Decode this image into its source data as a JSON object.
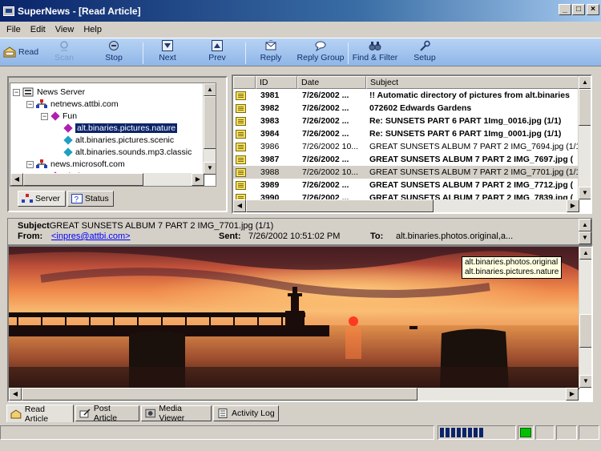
{
  "window": {
    "title": "SuperNews - [Read Article]",
    "minimize": "_",
    "maximize": "□",
    "close": "×"
  },
  "menu": [
    "File",
    "Edit",
    "View",
    "Help"
  ],
  "toolbar": {
    "read": "Read",
    "scan": "Scan",
    "stop": "Stop",
    "next": "Next",
    "prev": "Prev",
    "reply": "Reply",
    "reply_group": "Reply Group",
    "find_filter": "Find & Filter",
    "setup": "Setup"
  },
  "tree": {
    "root": "News Server",
    "server1": "netnews.attbi.com",
    "folder": "Fun",
    "groups": [
      "alt.binaries.pictures.nature",
      "alt.binaries.pictures.scenic",
      "alt.binaries.sounds.mp3.classic"
    ],
    "server2": "news.microsoft.com",
    "folder2": "windows"
  },
  "tree_tabs": {
    "server": "Server",
    "status": "Status"
  },
  "list": {
    "columns": {
      "id": "ID",
      "date": "Date",
      "subject": "Subject"
    },
    "rows": [
      {
        "id": "3981",
        "date": "7/26/2002 ...",
        "subject": "!! Automatic directory of pictures from alt.binaries",
        "bold": true
      },
      {
        "id": "3982",
        "date": "7/26/2002 ...",
        "subject": "072602 Edwards Gardens",
        "bold": true
      },
      {
        "id": "3983",
        "date": "7/26/2002 ...",
        "subject": "Re: SUNSETS PART 6 PART 1Img_0016.jpg (1/1)",
        "bold": true
      },
      {
        "id": "3984",
        "date": "7/26/2002 ...",
        "subject": "Re: SUNSETS PART 6 PART 1Img_0001.jpg (1/1)",
        "bold": true
      },
      {
        "id": "3986",
        "date": "7/26/2002 10...",
        "subject": "GREAT SUNSETS ALBUM 7 PART  2  IMG_7694.jpg (1/1)",
        "bold": false
      },
      {
        "id": "3987",
        "date": "7/26/2002 ...",
        "subject": "GREAT SUNSETS ALBUM 7 PART  2  IMG_7697.jpg (",
        "bold": true
      },
      {
        "id": "3988",
        "date": "7/26/2002 10...",
        "subject": "GREAT SUNSETS ALBUM 7 PART  2  IMG_7701.jpg (1/1)",
        "bold": false,
        "selected": true
      },
      {
        "id": "3989",
        "date": "7/26/2002 ...",
        "subject": "GREAT SUNSETS ALBUM 7 PART  2  IMG_7712.jpg (",
        "bold": true
      },
      {
        "id": "3990",
        "date": "7/26/2002 ...",
        "subject": "GREAT SUNSETS ALBUM 7 PART  2  IMG_7839.jpg (",
        "bold": true
      }
    ]
  },
  "article": {
    "subject_label": "Subject",
    "subject": "GREAT SUNSETS ALBUM 7 PART  2  IMG_7701.jpg (1/1)",
    "from_label": "From:",
    "from": "<inpres@attbi.com>",
    "sent_label": "Sent:",
    "sent": "7/26/2002 10:51:02 PM",
    "to_label": "To:",
    "to": "alt.binaries.photos.original,a...",
    "tooltip": [
      "alt.binaries.photos.original",
      "alt.binaries.pictures.nature"
    ]
  },
  "bottom_tabs": {
    "read_article": "Read Article",
    "post_article": "Post Article",
    "media_viewer": "Media Viewer",
    "activity_log": "Activity Log"
  },
  "status": {
    "progress_fraction": 0.6,
    "indicator_color": "#00c000"
  },
  "colors": {
    "toolbar_accent": "#8fb6e8",
    "selection": "#0a246a",
    "title_start": "#0a246a"
  }
}
